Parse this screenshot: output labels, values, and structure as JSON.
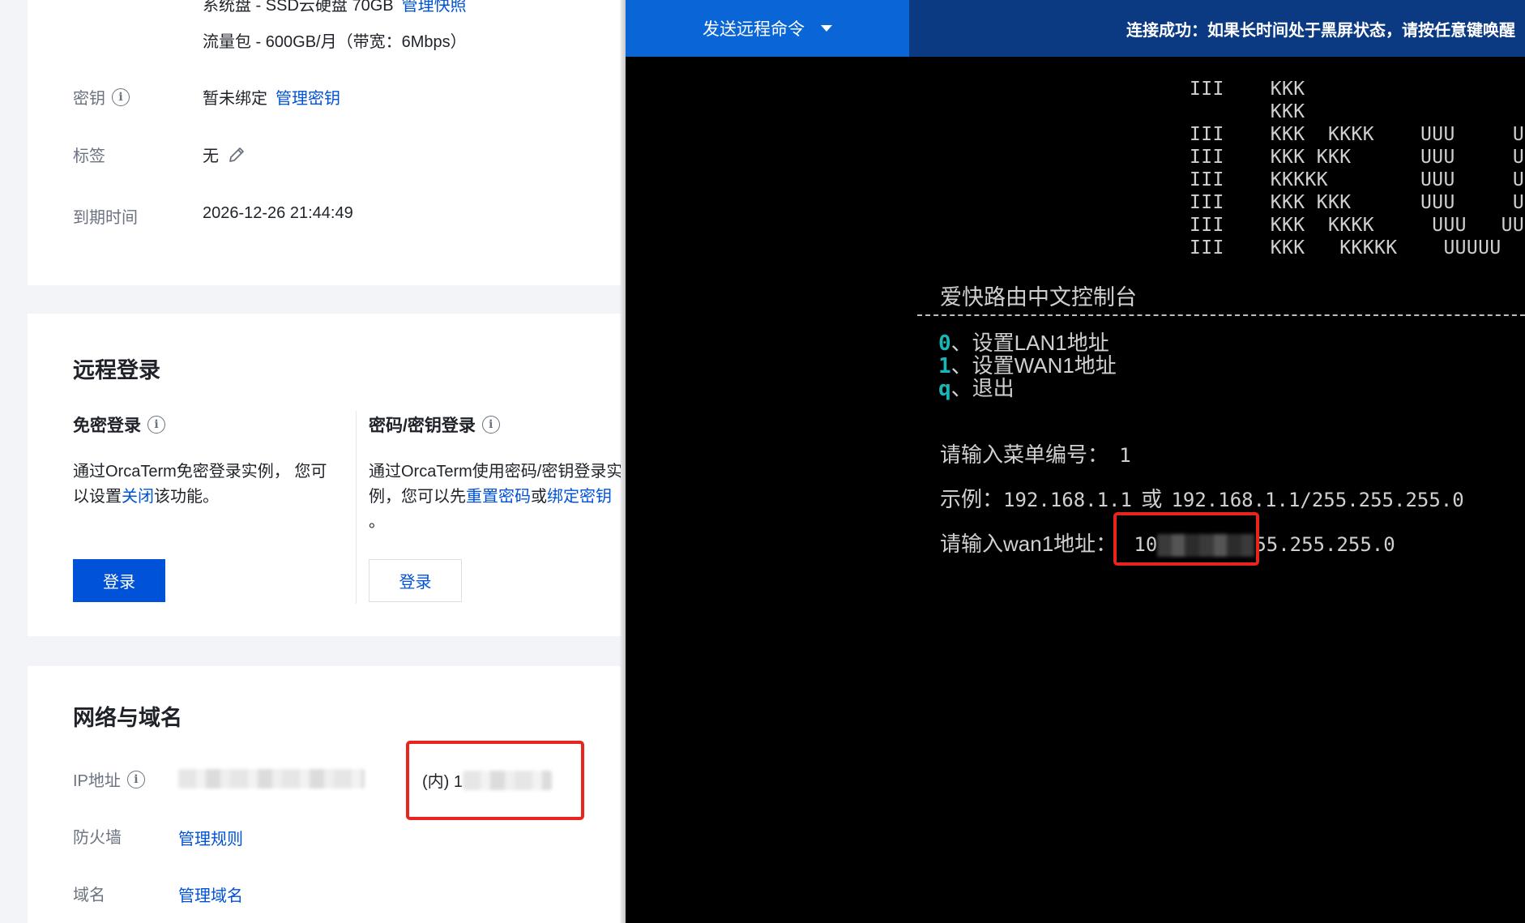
{
  "info": {
    "disk_top_text": "系统盘 - SSD云硬盘 70GB",
    "disk_top_link": "管理快照",
    "traffic_pack": "流量包 - 600GB/月（带宽：6Mbps）",
    "key_label": "密钥",
    "key_value": "暂未绑定",
    "key_link": "管理密钥",
    "tag_label": "标签",
    "tag_value": "无",
    "expire_label": "到期时间",
    "expire_value": "2026-12-26 21:44:49"
  },
  "remote_login": {
    "title": "远程登录",
    "free_login": {
      "title": "免密登录",
      "desc_line1": "通过OrcaTerm免密登录实例， 您可",
      "desc_line2_prefix": "以设置",
      "desc_link": "关闭",
      "desc_line2_suffix": "该功能。",
      "button": "登录"
    },
    "password_login": {
      "title": "密码/密钥登录",
      "desc_line1": "通过OrcaTerm使用密码/密钥登录实",
      "desc_line2_prefix": "例，您可以先",
      "link_reset": "重置密码",
      "or": "或",
      "link_bind": "绑定密钥",
      "desc_line3": "。",
      "button": "登录"
    }
  },
  "network": {
    "title": "网络与域名",
    "ip_label": "IP地址",
    "ip_inner_prefix": "(内) 1",
    "firewall_label": "防火墙",
    "firewall_link": "管理规则",
    "domain_label": "域名",
    "domain_link": "管理域名"
  },
  "terminal": {
    "send_command": "发送远程命令",
    "connection_msg": "连接成功：如果长时间处于黑屏状态，请按任意键唤醒",
    "ascii_art": [
      "III    KKK",
      "       KKK",
      "III    KKK  KKKK    UUU     UUU",
      "III    KKK KKK      UUU     UUU",
      "III    KKKKK        UUU     UUU",
      "III    KKK KKK      UUU     UUU",
      "III    KKK  KKKK     UUU   UUU",
      "III    KKK   KKKKK    UUUUU"
    ],
    "console_title": "爱快路由中文控制台",
    "menu": [
      {
        "key": "0",
        "text": "、设置LAN1地址"
      },
      {
        "key": "1",
        "text": "、设置WAN1地址"
      },
      {
        "key": "q",
        "text": "、退出"
      }
    ],
    "prompt_menu_label": "请输入菜单编号：",
    "prompt_menu_value": "1",
    "example_label": "示例：",
    "example_value1": "192.168.1.1",
    "example_or": "或",
    "example_value2": "192.168.1.1/255.255.255.0",
    "wan_prompt_label": "请输入wan1地址：",
    "wan_prompt_value_prefix": "10",
    "wan_prompt_value_suffix": "55.255.255.0"
  }
}
